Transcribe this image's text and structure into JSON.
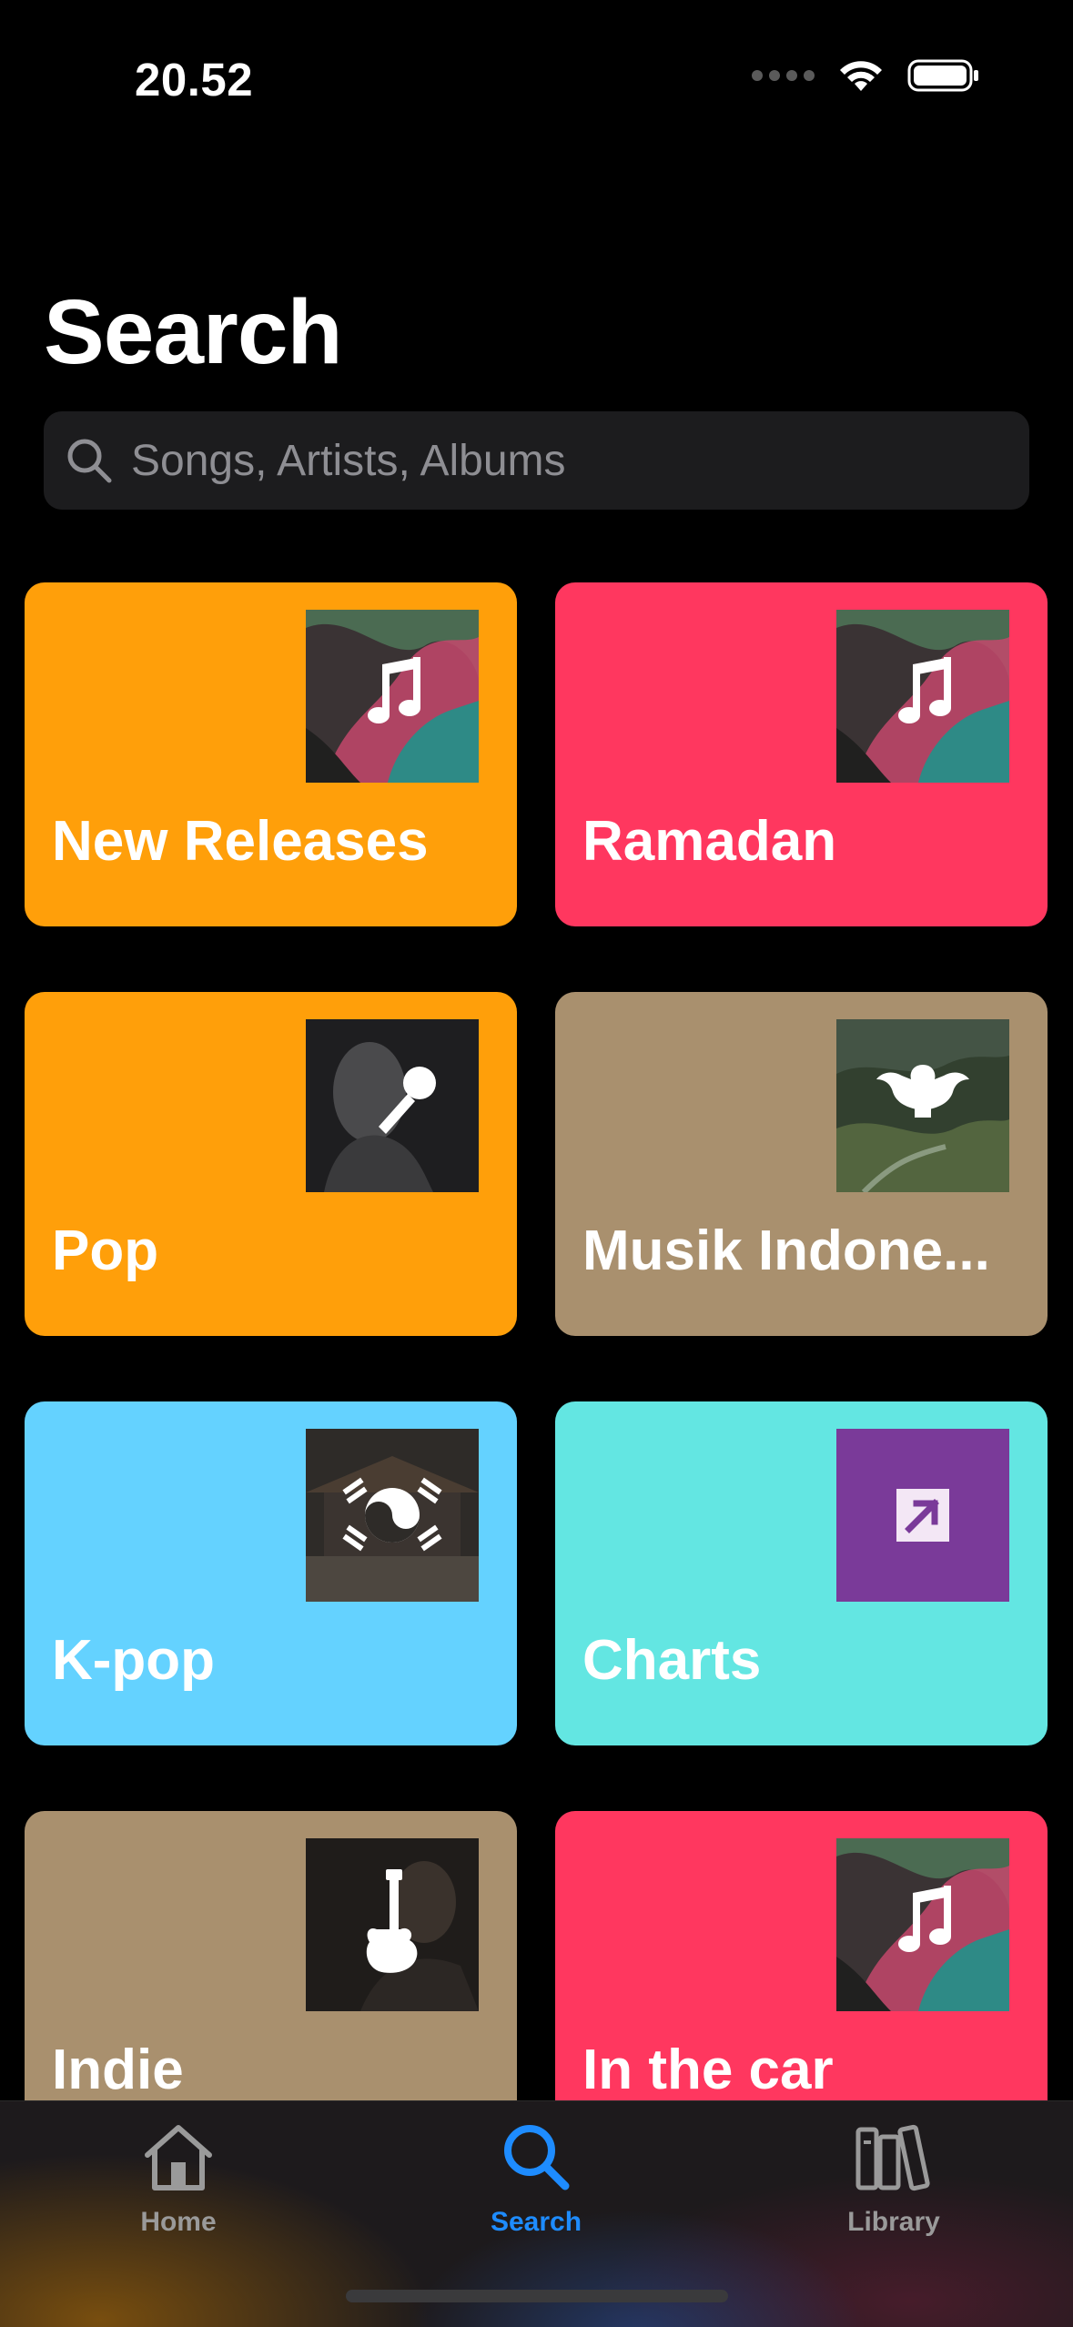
{
  "status": {
    "time": "20.52"
  },
  "page": {
    "title": "Search"
  },
  "search": {
    "placeholder": "Songs, Artists, Albums"
  },
  "categories": [
    {
      "label": "New Releases",
      "color": "#ff9f0a",
      "icon": "music-note-icon"
    },
    {
      "label": "Ramadan",
      "color": "#ff375f",
      "icon": "music-note-icon"
    },
    {
      "label": "Pop",
      "color": "#ff9f0a",
      "icon": "microphone-icon"
    },
    {
      "label": "Musik Indone...",
      "color": "#a9906e",
      "icon": "garuda-icon"
    },
    {
      "label": "K-pop",
      "color": "#64d2ff",
      "icon": "taegeuk-icon"
    },
    {
      "label": "Charts",
      "color": "#63e6e2",
      "icon": "arrow-up-right-icon"
    },
    {
      "label": "Indie",
      "color": "#a9906e",
      "icon": "guitar-icon"
    },
    {
      "label": "In the car",
      "color": "#ff375f",
      "icon": "music-note-icon"
    }
  ],
  "tabs": [
    {
      "label": "Home",
      "icon": "house-icon",
      "active": false
    },
    {
      "label": "Search",
      "icon": "magnifier-icon",
      "active": true
    },
    {
      "label": "Library",
      "icon": "books-icon",
      "active": false
    }
  ],
  "colors": {
    "accent": "#1e8cff",
    "inactive": "#9a9a9a",
    "search_bg": "#1c1c1e"
  }
}
